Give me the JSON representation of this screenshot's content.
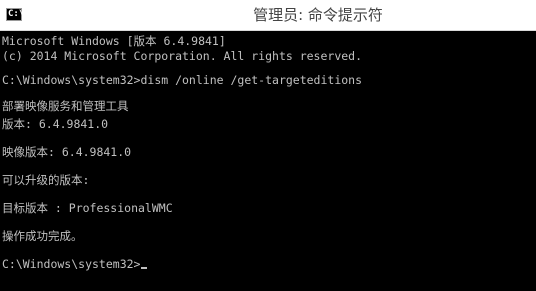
{
  "window": {
    "title": "管理员: 命令提示符",
    "icon": "cmd-icon",
    "icon_glyph": "C:\\"
  },
  "console": {
    "lines": [
      "Microsoft Windows [版本 6.4.9841]",
      "(c) 2014 Microsoft Corporation. All rights reserved.",
      "",
      "C:\\Windows\\system32>dism /online /get-targeteditions",
      "",
      "部署映像服务和管理工具",
      "版本: 6.4.9841.0",
      "",
      "映像版本: 6.4.9841.0",
      "",
      "可以升级的版本:",
      "",
      "目标版本 : ProfessionalWMC",
      "",
      "操作成功完成。",
      "",
      "C:\\Windows\\system32>"
    ]
  },
  "colors": {
    "console_background": "#000000",
    "console_text": "#c0c0c0",
    "titlebar_background": "#ffffff",
    "title_text": "#444444"
  }
}
